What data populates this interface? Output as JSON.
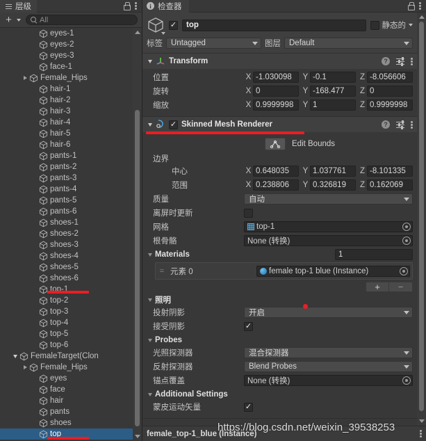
{
  "hierarchy": {
    "tab_label": "层级",
    "tab_icon": "hierarchy-icon",
    "lock_icon": "lock-icon",
    "menu_icon": "kebab-menu-icon",
    "add_button_label": "+",
    "search_placeholder": "All",
    "search_value": "",
    "items": [
      {
        "label": "eyes-1",
        "depth": 3,
        "twisty": "none",
        "selected": false
      },
      {
        "label": "eyes-2",
        "depth": 3,
        "twisty": "none",
        "selected": false
      },
      {
        "label": "eyes-3",
        "depth": 3,
        "twisty": "none",
        "selected": false
      },
      {
        "label": "face-1",
        "depth": 3,
        "twisty": "none",
        "selected": false
      },
      {
        "label": "Female_Hips",
        "depth": 2,
        "twisty": "closed",
        "selected": false
      },
      {
        "label": "hair-1",
        "depth": 3,
        "twisty": "none",
        "selected": false
      },
      {
        "label": "hair-2",
        "depth": 3,
        "twisty": "none",
        "selected": false
      },
      {
        "label": "hair-3",
        "depth": 3,
        "twisty": "none",
        "selected": false
      },
      {
        "label": "hair-4",
        "depth": 3,
        "twisty": "none",
        "selected": false
      },
      {
        "label": "hair-5",
        "depth": 3,
        "twisty": "none",
        "selected": false
      },
      {
        "label": "hair-6",
        "depth": 3,
        "twisty": "none",
        "selected": false
      },
      {
        "label": "pants-1",
        "depth": 3,
        "twisty": "none",
        "selected": false
      },
      {
        "label": "pants-2",
        "depth": 3,
        "twisty": "none",
        "selected": false
      },
      {
        "label": "pants-3",
        "depth": 3,
        "twisty": "none",
        "selected": false
      },
      {
        "label": "pants-4",
        "depth": 3,
        "twisty": "none",
        "selected": false
      },
      {
        "label": "pants-5",
        "depth": 3,
        "twisty": "none",
        "selected": false
      },
      {
        "label": "pants-6",
        "depth": 3,
        "twisty": "none",
        "selected": false
      },
      {
        "label": "shoes-1",
        "depth": 3,
        "twisty": "none",
        "selected": false
      },
      {
        "label": "shoes-2",
        "depth": 3,
        "twisty": "none",
        "selected": false
      },
      {
        "label": "shoes-3",
        "depth": 3,
        "twisty": "none",
        "selected": false
      },
      {
        "label": "shoes-4",
        "depth": 3,
        "twisty": "none",
        "selected": false
      },
      {
        "label": "shoes-5",
        "depth": 3,
        "twisty": "none",
        "selected": false
      },
      {
        "label": "shoes-6",
        "depth": 3,
        "twisty": "none",
        "selected": false
      },
      {
        "label": "top-1",
        "depth": 3,
        "twisty": "none",
        "selected": false
      },
      {
        "label": "top-2",
        "depth": 3,
        "twisty": "none",
        "selected": false
      },
      {
        "label": "top-3",
        "depth": 3,
        "twisty": "none",
        "selected": false
      },
      {
        "label": "top-4",
        "depth": 3,
        "twisty": "none",
        "selected": false
      },
      {
        "label": "top-5",
        "depth": 3,
        "twisty": "none",
        "selected": false
      },
      {
        "label": "top-6",
        "depth": 3,
        "twisty": "none",
        "selected": false
      },
      {
        "label": "FemaleTarget(Clon",
        "depth": 1,
        "twisty": "open",
        "selected": false
      },
      {
        "label": "Female_Hips",
        "depth": 2,
        "twisty": "closed",
        "selected": false
      },
      {
        "label": "eyes",
        "depth": 3,
        "twisty": "none",
        "selected": false
      },
      {
        "label": "face",
        "depth": 3,
        "twisty": "none",
        "selected": false
      },
      {
        "label": "hair",
        "depth": 3,
        "twisty": "none",
        "selected": false
      },
      {
        "label": "pants",
        "depth": 3,
        "twisty": "none",
        "selected": false
      },
      {
        "label": "shoes",
        "depth": 3,
        "twisty": "none",
        "selected": false
      },
      {
        "label": "top",
        "depth": 3,
        "twisty": "none",
        "selected": true
      }
    ]
  },
  "inspector": {
    "tab_label": "检查器",
    "tab_icon": "info-icon",
    "lock_icon": "lock-icon",
    "menu_icon": "kebab-menu-icon",
    "object": {
      "enabled": true,
      "name": "top",
      "static_label": "静态的",
      "static_checked": false,
      "tag_label": "标签",
      "tag_value": "Untagged",
      "layer_label": "图层",
      "layer_value": "Default"
    },
    "transform": {
      "title": "Transform",
      "position_label": "位置",
      "position": {
        "x": "-1.030098",
        "y": "-0.1",
        "z": "-8.056606"
      },
      "rotation_label": "旋转",
      "rotation": {
        "x": "0",
        "y": "-168.477",
        "z": "0"
      },
      "scale_label": "缩放",
      "scale": {
        "x": "0.9999998",
        "y": "1",
        "z": "0.9999998"
      },
      "axis_x": "X",
      "axis_y": "Y",
      "axis_z": "Z"
    },
    "skinned_mesh_renderer": {
      "title": "Skinned Mesh Renderer",
      "enabled": true,
      "edit_bounds_label": "Edit Bounds",
      "bounds_label": "边界",
      "center_label": "中心",
      "center": {
        "x": "0.648035",
        "y": "1.037761",
        "z": "-8.101335"
      },
      "extent_label": "范围",
      "extent": {
        "x": "0.238806",
        "y": "0.326819",
        "z": "0.162069"
      },
      "quality_label": "质量",
      "quality_value": "自动",
      "update_offscreen_label": "离屏时更新",
      "update_offscreen_checked": false,
      "mesh_label": "网格",
      "mesh_value": "top-1",
      "root_bone_label": "根骨骼",
      "root_bone_value": "None (转换)",
      "materials_label": "Materials",
      "materials_count": "1",
      "material_element_label": "元素 0",
      "material_element_value": "female top-1 blue (Instance)",
      "add_material_label": "+",
      "remove_material_label": "−",
      "lighting_label": "照明",
      "cast_shadows_label": "投射阴影",
      "cast_shadows_value": "开启",
      "receive_shadows_label": "接受阴影",
      "receive_shadows_checked": true,
      "probes_label": "Probes",
      "light_probes_label": "光照探测器",
      "light_probes_value": "混合探测器",
      "reflection_probes_label": "反射探测器",
      "reflection_probes_value": "Blend Probes",
      "anchor_override_label": "锚点覆盖",
      "anchor_override_value": "None (转换)",
      "additional_settings_label": "Additional Settings",
      "skinned_motion_vectors_label": "蒙皮运动矢量",
      "skinned_motion_vectors_checked": true
    },
    "bottom_bar_label": "female_top-1_blue (Instance)"
  },
  "watermark": {
    "text": "https://blog.csdn.net/weixin_39538253"
  },
  "annotation": {
    "color": "#ed1c24"
  }
}
